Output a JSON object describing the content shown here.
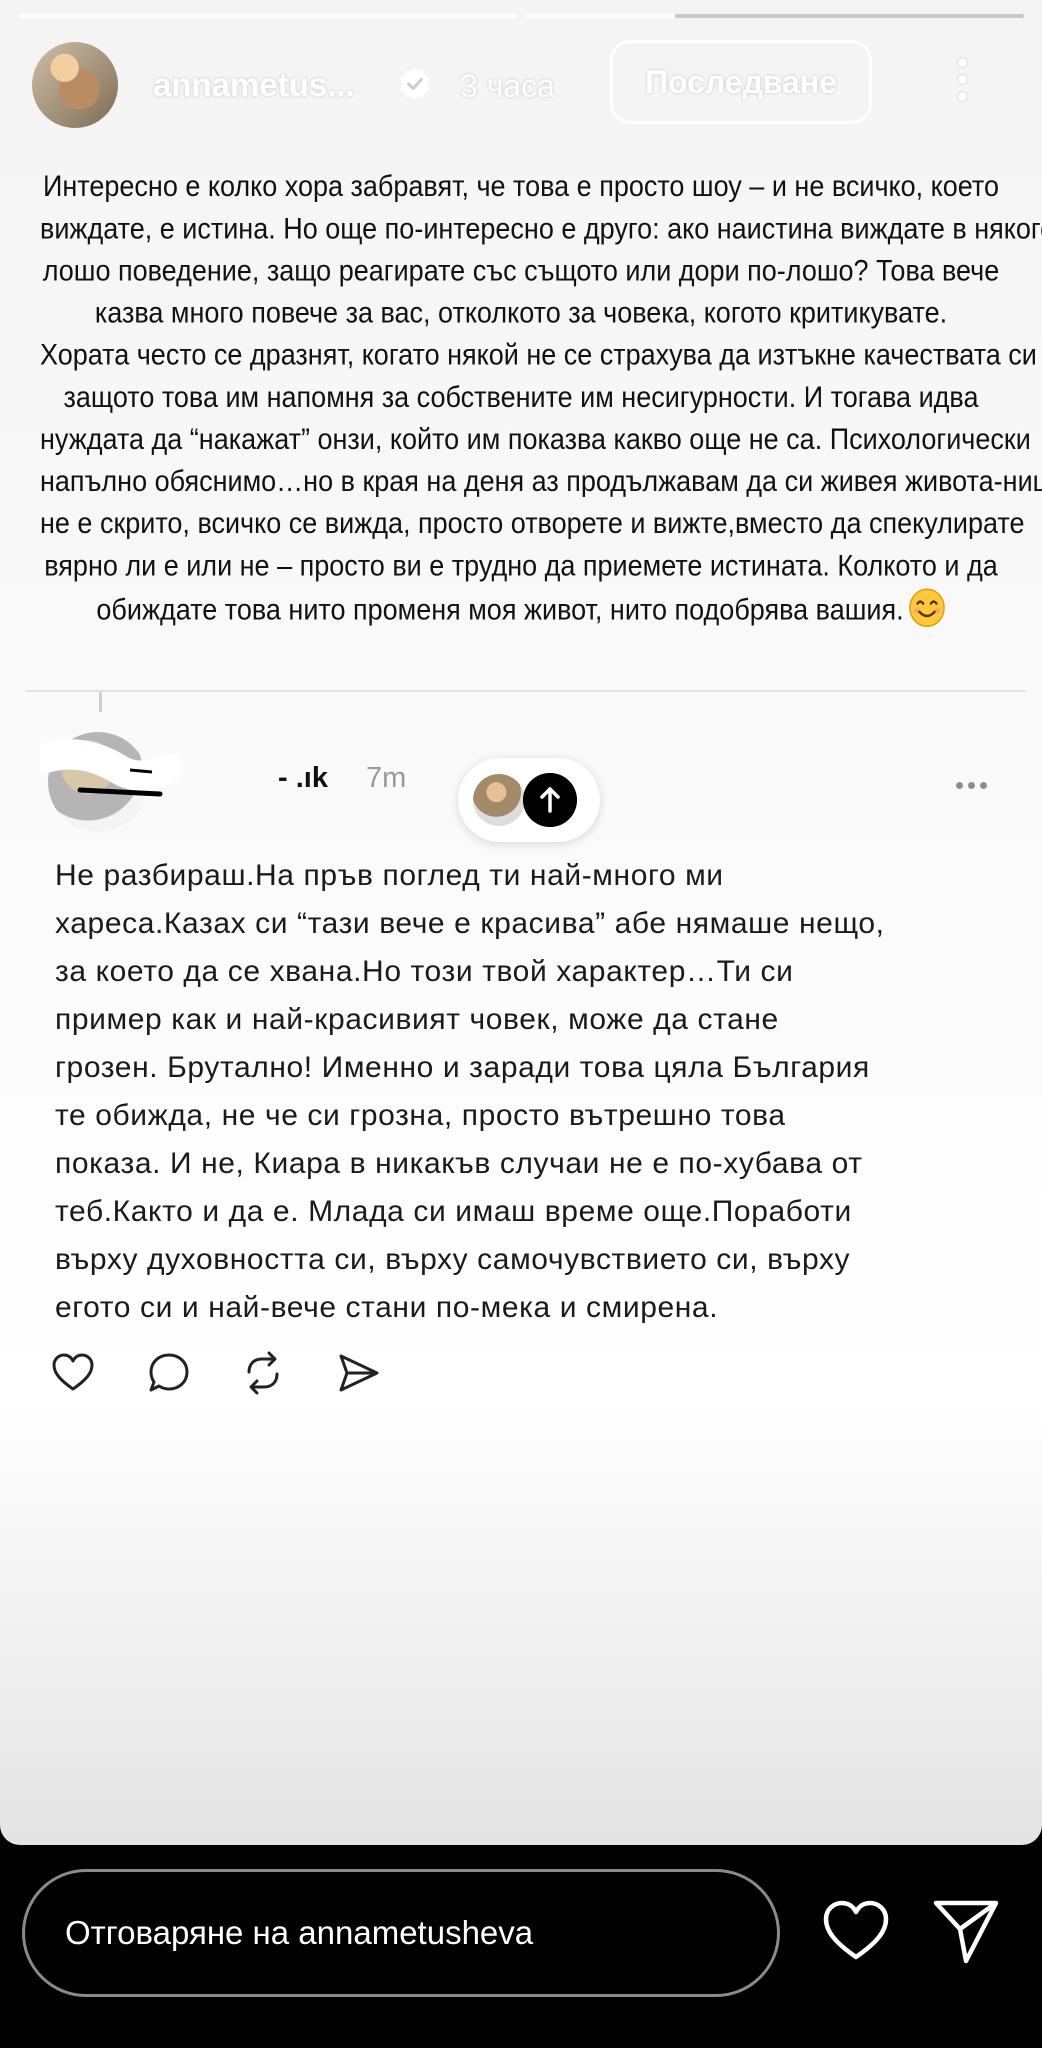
{
  "story": {
    "progress": [
      1.0,
      0.3
    ],
    "username": "annametus...",
    "time": "3 часа",
    "follow_label": "Последване",
    "caption_lines": [
      "Интересно е колко хора забравят, че това е просто шоу – и не всичко, което",
      "виждате, е истина. Но още по-интересно е друго: ако наистина виждате в някого",
      "лошо поведение, защо реагирате със същото или дори по-лошо? Това вече",
      "казва много повече за вас, отколкото за човека, когото критикувате.",
      "Хората често се дразнят, когато някой не се страхува да  изтъкне качествата си –",
      "защото това им напомня за собствените им несигурности. И тогава идва",
      "нуждата да “накажат” онзи, който им показва какво още не са. Психологически",
      "напълно обяснимо…но в края на деня аз продължавам да си живея  живота-нищо",
      "не е скрито, всичко се вижда, просто отворете и вижте,вместо да спекулирате",
      "вярно ли е или не – просто ви е трудно да приемете истината. Колкото и да",
      "обиждате това нито променя моя живот, нито подобрява вашия."
    ],
    "caption_emoji": "smiling-face-icon"
  },
  "thread": {
    "handle": "- .ık",
    "time": "7m",
    "body_lines": [
      "Не разбираш.На пръв поглед ти най-много ми",
      "хареса.Казах си “тази вече е красива” абе нямаше нещо,",
      "за което да се хвана.Но този твой характер…Ти си",
      "пример как и най-красивият човек, може да стане",
      "грозен. Брутално! Именно и заради това цяла България",
      "те обижда, не че си грозна, просто вътрешно това",
      "показа. И не, Киара в никакъв случаи не е по-хубава от",
      "теб.Както и да е. Млада си имаш време още.Поработи",
      "върху духовността си, върху самочувствието си, върху",
      "егото си и най-вече стани по-мека и смирена."
    ],
    "actions": [
      "heart-icon",
      "comment-icon",
      "repost-icon",
      "share-icon"
    ]
  },
  "reply": {
    "placeholder": "Отговаряне на annametusheva"
  },
  "colors": {
    "story_bg": "#f4f4f4",
    "text": "#111111",
    "muted": "#999999",
    "bar_bg": "#000000"
  }
}
